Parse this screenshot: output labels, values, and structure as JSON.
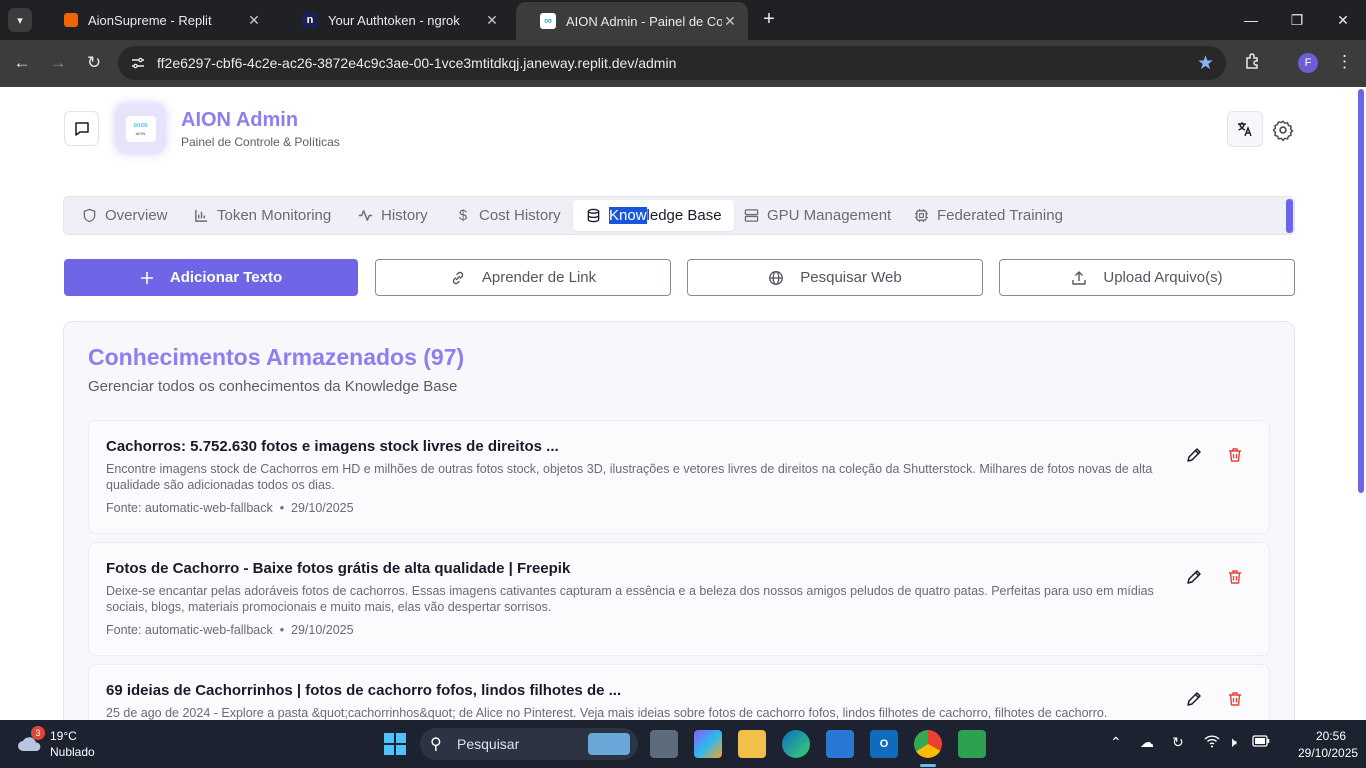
{
  "browser": {
    "tabs": [
      {
        "title": "AionSupreme - Replit"
      },
      {
        "title": "Your Authtoken - ngrok"
      },
      {
        "title": "AION Admin - Painel de Controle"
      }
    ],
    "new_tab": "+",
    "url": "ff2e6297-cbf6-4c2e-ac26-3872e4c9c3ae-00-1vce3mtitdkqj.janeway.replit.dev/admin",
    "profile_initial": "F"
  },
  "header": {
    "app_name": "AION Admin",
    "subtitle": "Painel de Controle & Políticas",
    "logo_text": "AION"
  },
  "nav_tabs": [
    {
      "label": "Overview"
    },
    {
      "label": "Token Monitoring"
    },
    {
      "label": "History"
    },
    {
      "label": "Cost History"
    },
    {
      "label_selected": "Know",
      "label_rest": "ledge Base"
    },
    {
      "label": "GPU Management"
    },
    {
      "label": "Federated Training"
    }
  ],
  "actions": {
    "add_text": "Adicionar Texto",
    "learn_link": "Aprender de Link",
    "search_web": "Pesquisar Web",
    "upload": "Upload Arquivo(s)"
  },
  "knowledge": {
    "title": "Conhecimentos Armazenados (97)",
    "subtitle": "Gerenciar todos os conhecimentos da Knowledge Base",
    "entries": [
      {
        "title": "Cachorros: 5.752.630 fotos e imagens stock livres de direitos ...",
        "description": "Encontre imagens stock de Cachorros em HD e milhões de outras fotos stock, objetos 3D, ilustrações e vetores livres de direitos na coleção da Shutterstock. Milhares de fotos novas de alta qualidade são adicionadas todos os dias.",
        "meta": "Fonte: automatic-web-fallback  •  29/10/2025"
      },
      {
        "title": "Fotos de Cachorro - Baixe fotos grátis de alta qualidade | Freepik",
        "description": "Deixe-se encantar pelas adoráveis fotos de cachorros. Essas imagens cativantes capturam a essência e a beleza dos nossos amigos peludos de quatro patas. Perfeitas para uso em mídias sociais, blogs, materiais promocionais e muito mais, elas vão despertar sorrisos.",
        "meta": "Fonte: automatic-web-fallback  •  29/10/2025"
      },
      {
        "title": "69 ideias de Cachorrinhos | fotos de cachorro fofos, lindos filhotes de ...",
        "description": "25 de ago de 2024 - Explore a pasta &quot;cachorrinhos&quot; de Alice no Pinterest. Veja mais ideias sobre fotos de cachorro fofos, lindos filhotes de cachorro, filhotes de cachorro.",
        "meta": ""
      }
    ]
  },
  "taskbar": {
    "weather_temp": "19°C",
    "weather_desc": "Nublado",
    "weather_badge": "3",
    "search_placeholder": "Pesquisar",
    "time": "20:56",
    "date": "29/10/2025"
  }
}
